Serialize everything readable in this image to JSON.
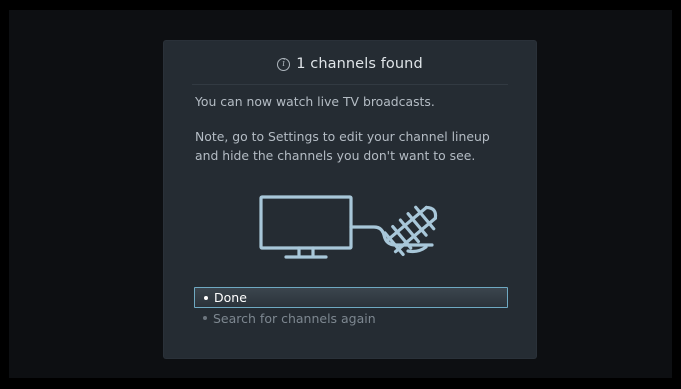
{
  "dialog": {
    "title": "1 channels found",
    "title_icon": "info-icon",
    "message_line1": "You can now watch live TV broadcasts.",
    "message_line2": "Note, go to Settings to edit your channel lineup and hide the channels you don't want to see.",
    "illustration_icon": "tv-with-antenna-icon",
    "options": [
      {
        "label": "Done",
        "selected": true
      },
      {
        "label": "Search for channels again",
        "selected": false
      }
    ]
  },
  "colors": {
    "background": "#000000",
    "dialog_background": "#252c33",
    "focus_border": "#6fa9c2",
    "title_text": "#dfe4e8",
    "body_text": "#b4bcc4",
    "unselected_text": "#7d8790"
  }
}
